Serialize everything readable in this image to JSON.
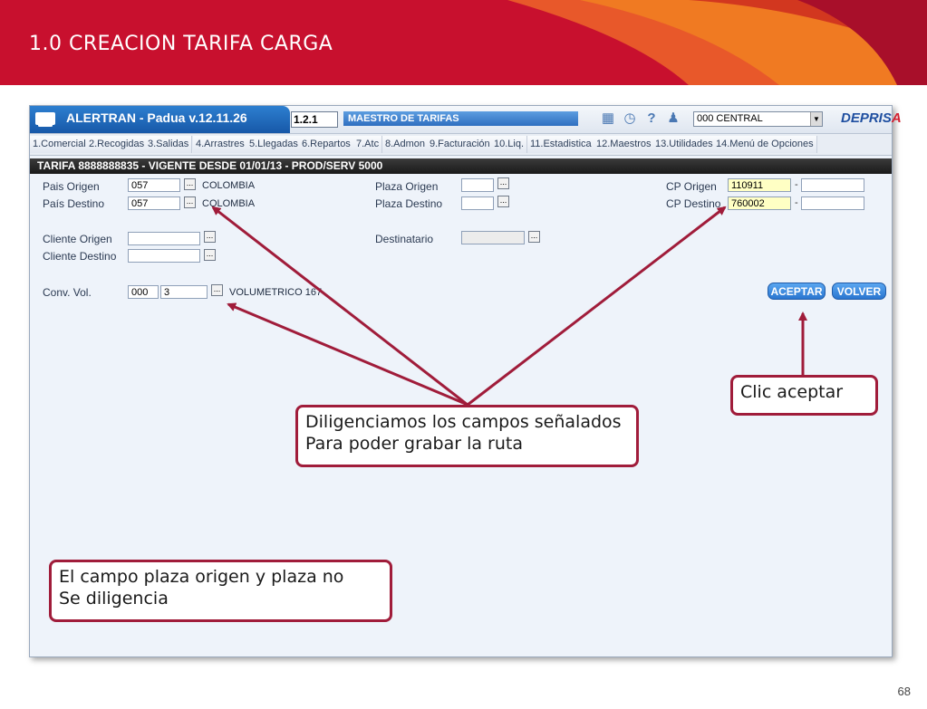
{
  "slide": {
    "title": "1.0 CREACION TARIFA CARGA",
    "page_number": "68"
  },
  "app": {
    "title": "ALERTRAN - Padua  v.12.11.26",
    "version_box": "1.2.1",
    "module": "MAESTRO DE TARIFAS",
    "selected_office": "000 CENTRAL",
    "brand": "DEPRIS",
    "brand_mark": "A",
    "icons": [
      "calendar-icon",
      "clock-icon",
      "help-icon",
      "user-icon"
    ]
  },
  "menu": [
    "1.Comercial",
    "2.Recogidas",
    "3.Salidas",
    "4.Arrastres",
    "5.Llegadas",
    "6.Repartos",
    "7.Atc",
    "8.Admon",
    "9.Facturación",
    "10.Liq.",
    "11.Estadistica",
    "12.Maestros",
    "13.Utilidades",
    "14.Menú de Opciones"
  ],
  "tarifa_header": "TARIFA 8888888835   -  VIGENTE DESDE 01/01/13   -   PROD/SERV 5000",
  "form": {
    "pais_origen": {
      "label": "Pais Origen",
      "value": "057",
      "desc": "COLOMBIA"
    },
    "pais_destino": {
      "label": "País Destino",
      "value": "057",
      "desc": "COLOMBIA"
    },
    "plaza_origen": {
      "label": "Plaza Origen",
      "value": ""
    },
    "plaza_destino": {
      "label": "Plaza Destino",
      "value": ""
    },
    "cp_origen": {
      "label": "CP Origen",
      "value": "110911",
      "value2": ""
    },
    "cp_destino": {
      "label": "CP Destino",
      "value": "760002",
      "value2": ""
    },
    "cliente_origen": {
      "label": "Cliente Origen",
      "value": ""
    },
    "cliente_destino": {
      "label": "Cliente Destino",
      "value": ""
    },
    "destinatario": {
      "label": "Destinatario",
      "value": ""
    },
    "conv_vol": {
      "label": "Conv. Vol.",
      "value": "000",
      "value2": "3",
      "desc": "VOLUMETRICO 167"
    },
    "dash": "-",
    "dots": "..."
  },
  "buttons": {
    "aceptar": "ACEPTAR",
    "volver": "VOLVER"
  },
  "notes": {
    "clic_aceptar": "Clic aceptar",
    "diligenciamos_1": "Diligenciamos los campos señalados",
    "diligenciamos_2": "Para poder grabar la ruta",
    "plaza_1": "El campo plaza origen y plaza no",
    "plaza_2": "Se diligencia"
  },
  "colors": {
    "header_red": "#c8102e",
    "annotation": "#a01c3a",
    "button_blue": "#2a76d0"
  }
}
